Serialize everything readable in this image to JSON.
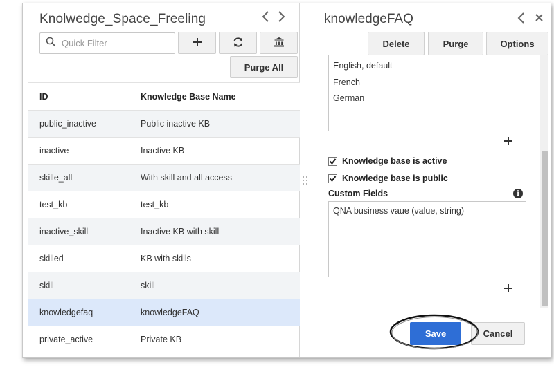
{
  "left_panel": {
    "title": "Knolwedge_Space_Freeling",
    "filter_placeholder": "Quick Filter",
    "purge_all_label": "Purge All",
    "icons": [
      "chevron-left-icon",
      "chevron-right-icon",
      "search-icon",
      "plus-icon",
      "refresh-icon",
      "bank-icon"
    ],
    "table": {
      "headers": {
        "id": "ID",
        "name": "Knowledge Base Name"
      },
      "rows": [
        {
          "id": "public_inactive",
          "name": "Public inactive KB"
        },
        {
          "id": "inactive",
          "name": "Inactive KB"
        },
        {
          "id": "skille_all",
          "name": "With skill and all access"
        },
        {
          "id": "test_kb",
          "name": "test_kb"
        },
        {
          "id": "inactive_skill",
          "name": "Inactive KB with skill"
        },
        {
          "id": "skilled",
          "name": "KB with skills"
        },
        {
          "id": "skill",
          "name": "skill"
        },
        {
          "id": "knowledgefaq",
          "name": "knowledgeFAQ"
        },
        {
          "id": "private_active",
          "name": "Private KB"
        }
      ],
      "selected_row": "knowledgefaq"
    }
  },
  "right_panel": {
    "title": "knowledgeFAQ",
    "icons": [
      "chevron-left-icon",
      "close-icon",
      "plus-icon",
      "checkbox-checked-icon",
      "info-icon"
    ],
    "buttons": {
      "delete": "Delete",
      "purge": "Purge",
      "options": "Options",
      "save": "Save",
      "cancel": "Cancel"
    },
    "languages": [
      "English, default",
      "French",
      "German"
    ],
    "checkboxes": {
      "active": {
        "label": "Knowledge base is active",
        "checked": true
      },
      "public": {
        "label": "Knowledge base is public",
        "checked": true
      }
    },
    "custom_fields": {
      "label": "Custom Fields",
      "info_glyph": "i",
      "items": [
        "QNA business vaue (value, string)"
      ]
    }
  },
  "colors": {
    "selected_row": "#dce8fa",
    "alt_row": "#f2f4f6",
    "primary_button": "#2e6ed6",
    "toolbar_button": "#f1f1f1"
  }
}
